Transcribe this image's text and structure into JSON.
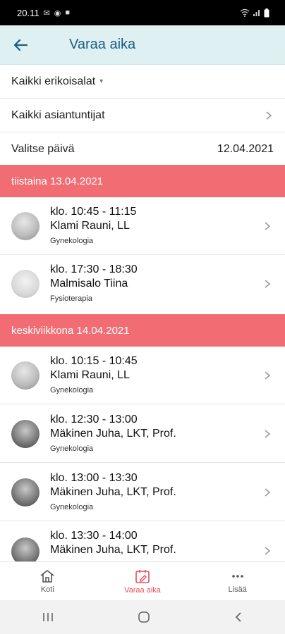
{
  "status_bar": {
    "time": "20.11",
    "left_icons": [
      "mail-icon",
      "app-icon",
      "app-icon-2"
    ],
    "right_icons": [
      "wifi-icon",
      "signal-icon",
      "battery-icon"
    ]
  },
  "header": {
    "title": "Varaa aika"
  },
  "filters": {
    "specialties": "Kaikki erikoisalat",
    "experts": "Kaikki asiantuntijat",
    "date_label": "Valitse päivä",
    "date_value": "12.04.2021"
  },
  "days": [
    {
      "title": "tiistaina 13.04.2021",
      "slots": [
        {
          "time": "klo. 10:45 - 11:15",
          "name": "Klami Rauni, LL",
          "specialty": "Gynekologia"
        },
        {
          "time": "klo. 17:30 - 18:30",
          "name": "Malmisalo Tiina",
          "specialty": "Fysioterapia"
        }
      ]
    },
    {
      "title": "keskiviikkona 14.04.2021",
      "slots": [
        {
          "time": "klo. 10:15 - 10:45",
          "name": "Klami Rauni, LL",
          "specialty": "Gynekologia"
        },
        {
          "time": "klo. 12:30 - 13:00",
          "name": "Mäkinen Juha, LKT, Prof.",
          "specialty": "Gynekologia"
        },
        {
          "time": "klo. 13:00 - 13:30",
          "name": "Mäkinen Juha, LKT, Prof.",
          "specialty": "Gynekologia"
        },
        {
          "time": "klo. 13:30 - 14:00",
          "name": "Mäkinen Juha, LKT, Prof.",
          "specialty": ""
        }
      ]
    }
  ],
  "bottom_nav": [
    {
      "label": "Koti",
      "icon": "home-icon"
    },
    {
      "label": "Varaa aika",
      "icon": "calendar-edit-icon",
      "active": true
    },
    {
      "label": "Lisää",
      "icon": "more-icon"
    }
  ],
  "system_nav": [
    "recent-apps-icon",
    "home-circle-icon",
    "back-chevron-icon"
  ],
  "colors": {
    "accent": "#f26d73",
    "header_bg": "#dff0f3",
    "title": "#1b5e7f"
  }
}
